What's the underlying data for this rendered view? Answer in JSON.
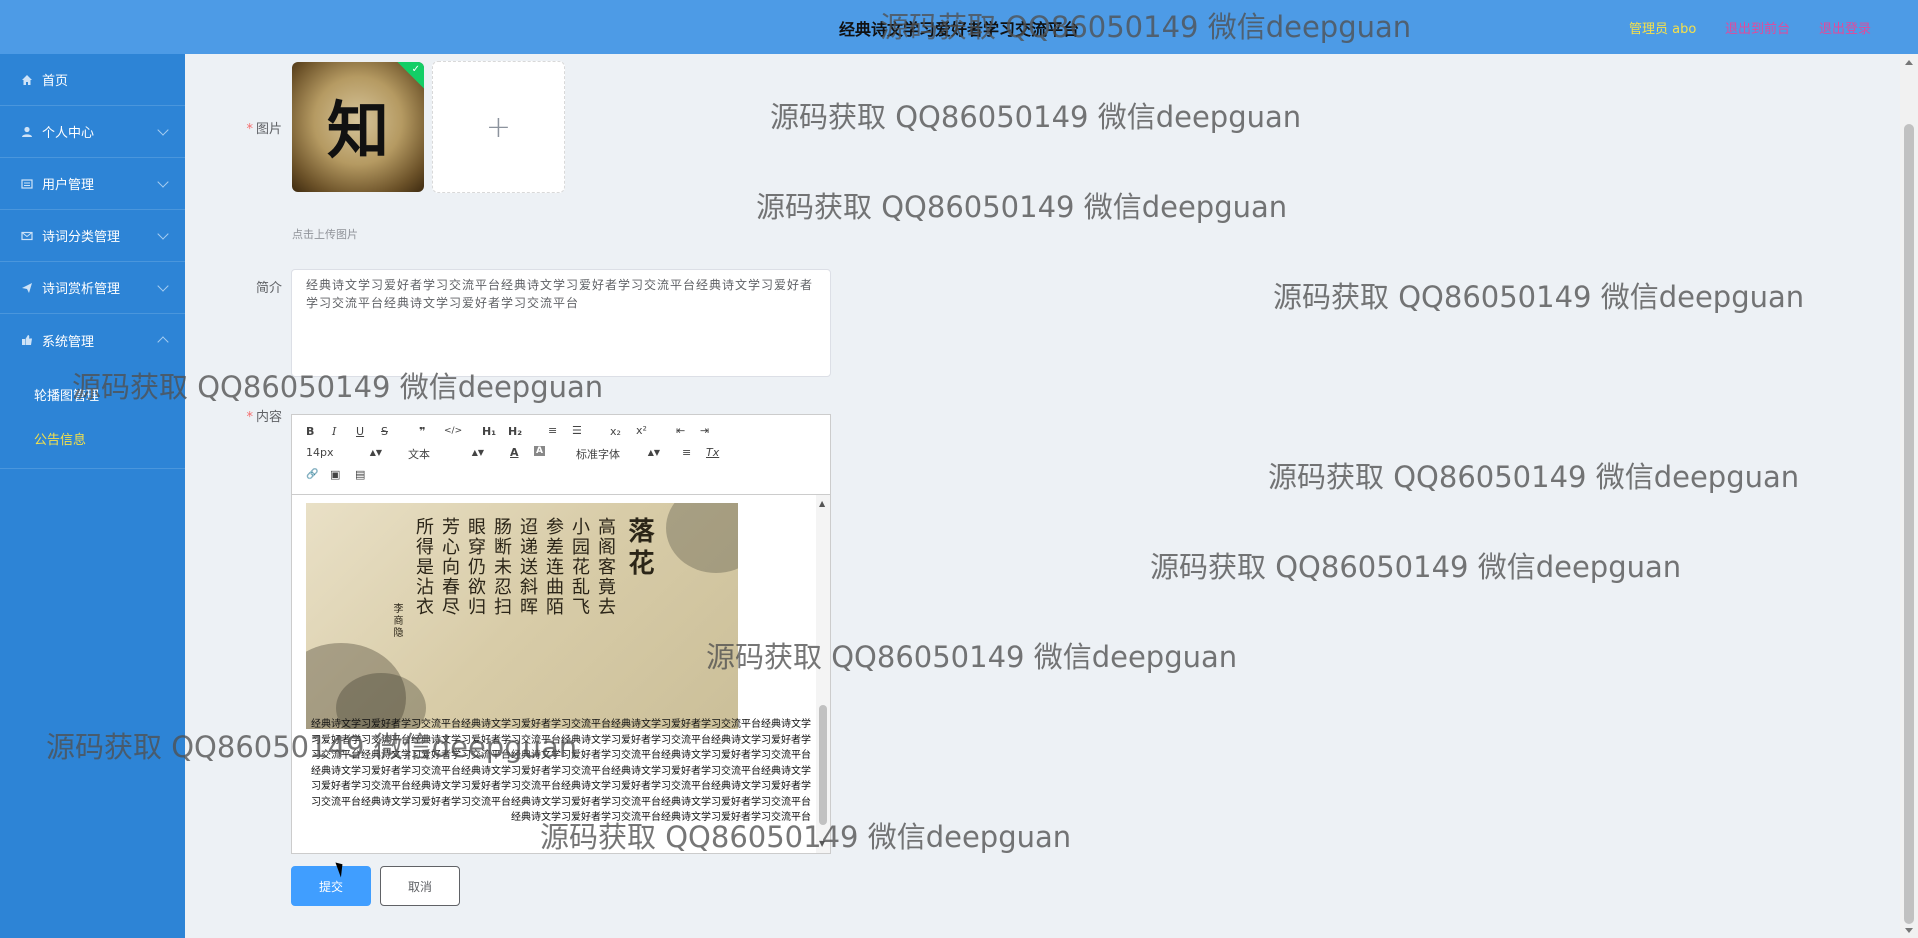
{
  "header": {
    "title": "经典诗文学习爱好者学习交流平台",
    "user": "管理员 abo",
    "back_front": "退出到前台",
    "logout": "退出登录"
  },
  "sidebar": {
    "items": [
      {
        "label": "首页",
        "icon": "home-icon"
      },
      {
        "label": "个人中心",
        "icon": "user-icon"
      },
      {
        "label": "用户管理",
        "icon": "list-icon"
      },
      {
        "label": "诗词分类管理",
        "icon": "mail-icon"
      },
      {
        "label": "诗词赏析管理",
        "icon": "send-icon"
      },
      {
        "label": "系统管理",
        "icon": "thumb-icon"
      }
    ],
    "subitems": [
      {
        "label": "轮播图管理"
      },
      {
        "label": "公告信息"
      }
    ]
  },
  "form": {
    "image_label": "图片",
    "upload_tip": "点击上传图片",
    "thumb_char": "知",
    "plus": "+",
    "intro_label": "简介",
    "intro_value": "经典诗文学习爱好者学习交流平台经典诗文学习爱好者学习交流平台经典诗文学习爱好者学习交流平台经典诗文学习爱好者学习交流平台",
    "content_label": "内容",
    "submit": "提交",
    "cancel": "取消"
  },
  "editor": {
    "toolbar": {
      "bold": "B",
      "italic": "I",
      "underline": "U",
      "strike": "S",
      "quote": "❞",
      "code": "</>",
      "h1": "H₁",
      "h2": "H₂",
      "ol": "≡",
      "ul": "☰",
      "sub": "x₂",
      "sup": "x²",
      "outdent": "⇤",
      "indent": "⇥",
      "size": "14px",
      "header": "文本",
      "color": "A",
      "bg": "A",
      "font": "标准字体",
      "align": "≡",
      "clean": "Tx",
      "link": "🔗",
      "image": "▣",
      "video": "▤"
    },
    "poem_title": "落花",
    "poem_cols": [
      "高阁客竟去",
      "小园花乱飞",
      "参差连曲陌",
      "迢递送斜晖",
      "肠断未忍扫",
      "眼穿仍欲归",
      "芳心向春尽",
      "所得是沾衣"
    ],
    "poem_author": "李商隐",
    "content": "经典诗文学习爱好者学习交流平台经典诗文学习爱好者学习交流平台经典诗文学习爱好者学习交流平台经典诗文学习爱好者学习交流平台经典诗文学习爱好者学习交流平台经典诗文学习爱好者学习交流平台经典诗文学习爱好者学习交流平台经典诗文学习爱好者学习交流平台经典诗文学习爱好者学习交流平台经典诗文学习爱好者学习交流平台经典诗文学习爱好者学习交流平台经典诗文学习爱好者学习交流平台经典诗文学习爱好者学习交流平台经典诗文学习爱好者学习交流平台经典诗文学习爱好者学习交流平台经典诗文学习爱好者学习交流平台经典诗文学习爱好者学习交流平台经典诗文学习爱好者学习交流平台经典诗文学习爱好者学习交流平台经典诗文学习爱好者学习交流平台经典诗文学习爱好者学习交流平台经典诗文学习爱好者学习交流平台"
  },
  "watermark": "源码获取 QQ86050149 微信deepguan",
  "colors": {
    "header": "#4d9be6",
    "sidebar": "#2d84d6",
    "active": "#f5e04a",
    "primary": "#409eff",
    "required": "#f56c6c"
  }
}
